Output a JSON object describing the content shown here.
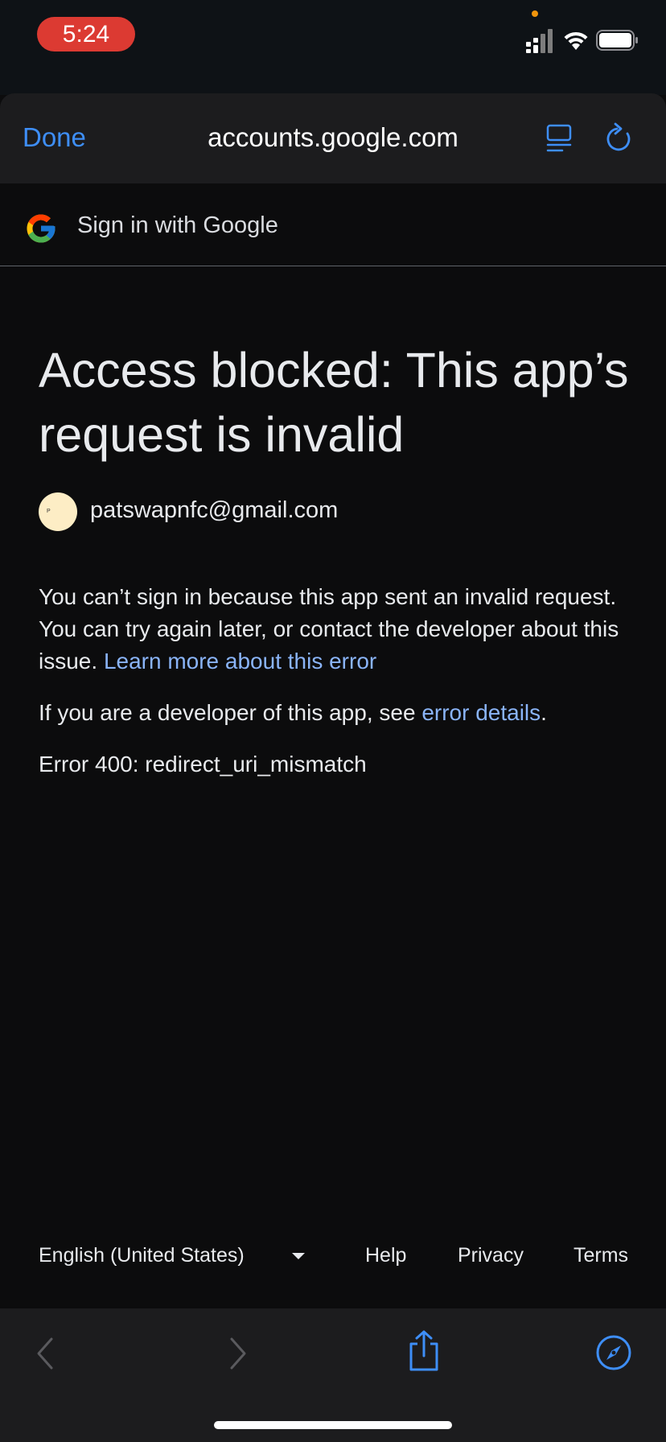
{
  "status_bar": {
    "time": "5:24",
    "time_pill_color": "#dc3a32",
    "icons": [
      "cellular-signal-icon",
      "wifi-icon",
      "battery-icon"
    ]
  },
  "browser": {
    "done_label": "Done",
    "url": "accounts.google.com",
    "accent_color": "#3e8ef7",
    "icons": [
      "reader-view-icon",
      "reload-icon"
    ]
  },
  "google_bar": {
    "logo": "google-g-icon",
    "label": "Sign in with Google"
  },
  "content": {
    "heading": "Access blocked: This app’s request is invalid",
    "account": {
      "avatar_letter": "P",
      "email": "patswapnfc@gmail.com"
    },
    "message": "You can’t sign in because this app sent an invalid request. You can try again later, or contact the developer about this issue.",
    "learn_more_link": "Learn more about this error",
    "developer_text": "If you are a developer of this app, see",
    "error_details_link": "error details",
    "developer_suffix": ".",
    "error_code": "Error 400: redirect_uri_mismatch",
    "link_color": "#8ab4f8"
  },
  "footer": {
    "language": "English (United States)",
    "help": "Help",
    "privacy": "Privacy",
    "terms": "Terms"
  },
  "toolbar": {
    "icons": [
      "back-icon",
      "forward-icon",
      "share-icon",
      "compass-icon"
    ]
  }
}
